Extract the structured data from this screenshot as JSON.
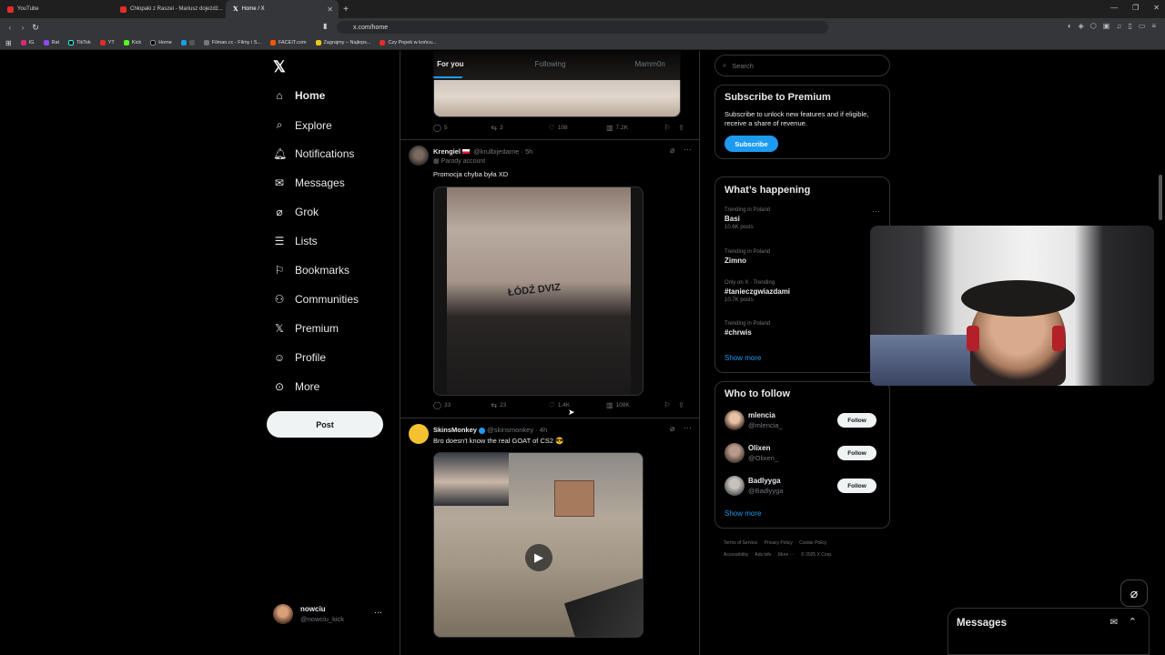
{
  "browser": {
    "tabs": [
      {
        "label": "YouTube"
      },
      {
        "label": "Chłopaki z Raszei - Mariusz dojeżdż..."
      },
      {
        "label": "Home / X"
      }
    ],
    "url": "x.com/home",
    "bookmarks": [
      "IG",
      "Rat",
      "TikTok",
      "YT",
      "Kick",
      "Home",
      "Filman.cc - Filmy i S...",
      "FACEIT.com",
      "Zagrajmy – Najleps...",
      "Czy Popek w końcu..."
    ]
  },
  "nav": {
    "items": [
      {
        "label": "Home",
        "icon": "home-icon"
      },
      {
        "label": "Explore",
        "icon": "search-icon"
      },
      {
        "label": "Notifications",
        "icon": "bell-icon"
      },
      {
        "label": "Messages",
        "icon": "envelope-icon"
      },
      {
        "label": "Grok",
        "icon": "grok-icon"
      },
      {
        "label": "Lists",
        "icon": "list-icon"
      },
      {
        "label": "Bookmarks",
        "icon": "bookmark-icon"
      },
      {
        "label": "Communities",
        "icon": "people-icon"
      },
      {
        "label": "Premium",
        "icon": "x-icon"
      },
      {
        "label": "Profile",
        "icon": "person-icon"
      },
      {
        "label": "More",
        "icon": "more-circle-icon"
      }
    ],
    "post_label": "Post",
    "account": {
      "name": "nowciu",
      "handle": "@nowciu_kick"
    }
  },
  "feed": {
    "tabs": [
      "For you",
      "Following",
      "Mamm0n"
    ],
    "first_actions": {
      "replies": "5",
      "reposts": "3",
      "likes": "108",
      "views": "7.2K"
    },
    "tweets": [
      {
        "name": "Krengiel",
        "handle": "@krulbijedame",
        "time": "5h",
        "badge": "Parody account",
        "text": "Promocja chyba była XD",
        "media_text": "ŁÓDŹ DVIZ",
        "replies": "33",
        "reposts": "23",
        "likes": "1.4K",
        "views": "108K"
      },
      {
        "name": "SkinsMonkey",
        "handle": "@skinsmonkey",
        "time": "4h",
        "text": "Bro doesn't know the real GOAT of CS2 😎"
      }
    ]
  },
  "right": {
    "search_placeholder": "Search",
    "premium": {
      "title": "Subscribe to Premium",
      "body": "Subscribe to unlock new features and if eligible, receive a share of revenue.",
      "button": "Subscribe"
    },
    "happening": {
      "title": "What’s happening",
      "trends": [
        {
          "context": "Trending in Poland",
          "name": "Basi",
          "count": "10.6K posts"
        },
        {
          "context": "Trending in Poland",
          "name": "Zimno",
          "count": ""
        },
        {
          "context": "Only on X · Trending",
          "name": "#tanieczgwiazdami",
          "count": "10.7K posts"
        },
        {
          "context": "Trending in Poland",
          "name": "#chrwis",
          "count": ""
        }
      ],
      "show_more": "Show more"
    },
    "who_to_follow": {
      "title": "Who to follow",
      "users": [
        {
          "name": "mlencia",
          "handle": "@mlencia_",
          "button": "Follow"
        },
        {
          "name": "Olixen",
          "handle": "@Olixen_",
          "button": "Follow"
        },
        {
          "name": "Badlyyga",
          "handle": "@Badlyyga",
          "button": "Follow"
        }
      ],
      "show_more": "Show more"
    },
    "footer": [
      "Terms of Service",
      "Privacy Policy",
      "Cookie Policy",
      "Accessibility",
      "Ads info",
      "More ···",
      "© 2025 X Corp."
    ]
  },
  "messages_drawer": {
    "title": "Messages"
  },
  "colors": {
    "accent": "#1d9bf0",
    "background": "#000000",
    "border": "#2f3336",
    "muted": "#71767b"
  }
}
